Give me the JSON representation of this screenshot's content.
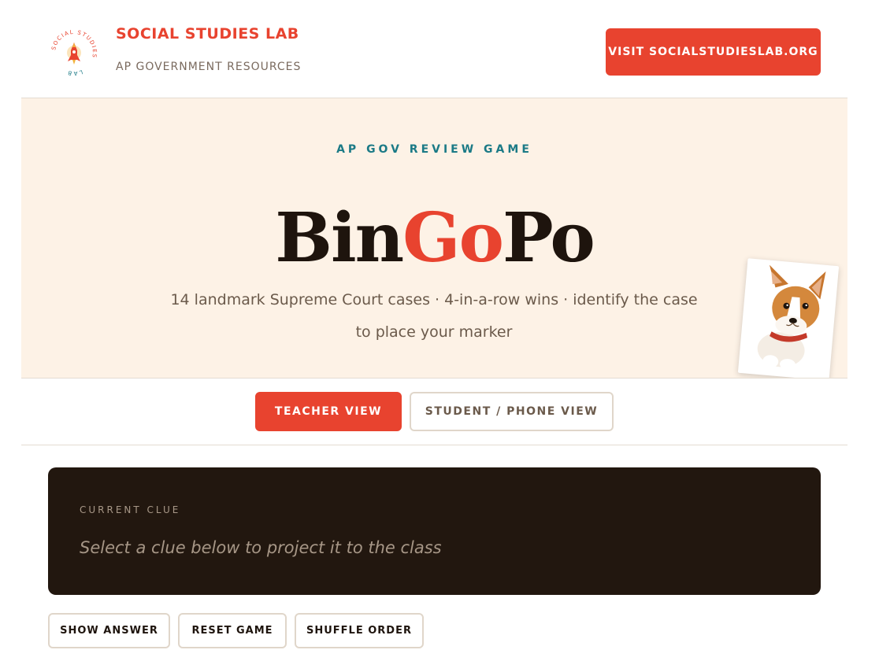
{
  "header": {
    "brand_title": "SOCIAL STUDIES LAB",
    "brand_subtitle": "AP GOVERNMENT RESOURCES",
    "visit_button": "VISIT SOCIALSTUDIESLAB.ORG",
    "logo_ring_text": "SOCIAL STUDIES LAB"
  },
  "hero": {
    "eyebrow": "AP GOV REVIEW GAME",
    "title_part1": "Bin",
    "title_accent": "Go",
    "title_part2": "Po",
    "subtitle": "14 landmark Supreme Court cases · 4-in-a-row wins · identify the case to place your marker"
  },
  "tabs": {
    "teacher": "TEACHER VIEW",
    "student": "STUDENT / PHONE VIEW",
    "active": "teacher"
  },
  "clue": {
    "label": "CURRENT CLUE",
    "placeholder": "Select a clue below to project it to the class"
  },
  "actions": {
    "show_answer": "SHOW ANSWER",
    "reset_game": "RESET GAME",
    "shuffle_order": "SHUFFLE ORDER"
  },
  "colors": {
    "accent": "#e8432f",
    "teal": "#1b7a86",
    "dark_panel": "#22170f",
    "hero_bg": "#fdf2e6"
  }
}
